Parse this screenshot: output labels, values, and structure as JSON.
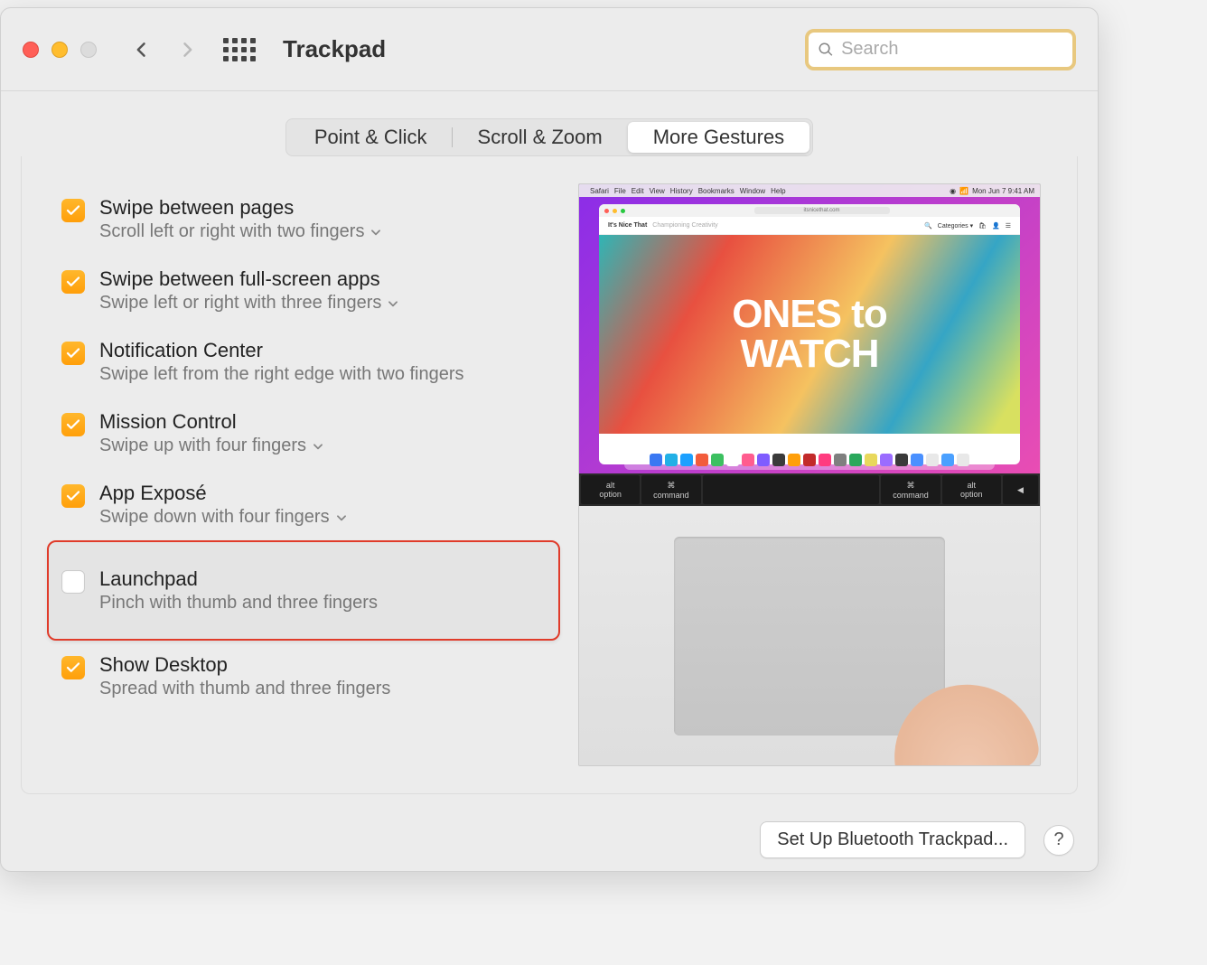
{
  "window": {
    "title": "Trackpad"
  },
  "search": {
    "placeholder": "Search"
  },
  "tabs": [
    {
      "label": "Point & Click",
      "active": false
    },
    {
      "label": "Scroll & Zoom",
      "active": false
    },
    {
      "label": "More Gestures",
      "active": true
    }
  ],
  "options": [
    {
      "title": "Swipe between pages",
      "sub": "Scroll left or right with two fingers",
      "checked": true,
      "dropdown": true
    },
    {
      "title": "Swipe between full-screen apps",
      "sub": "Swipe left or right with three fingers",
      "checked": true,
      "dropdown": true
    },
    {
      "title": "Notification Center",
      "sub": "Swipe left from the right edge with two fingers",
      "checked": true,
      "dropdown": false
    },
    {
      "title": "Mission Control",
      "sub": "Swipe up with four fingers",
      "checked": true,
      "dropdown": true
    },
    {
      "title": "App Exposé",
      "sub": "Swipe down with four fingers",
      "checked": true,
      "dropdown": true
    },
    {
      "title": "Launchpad",
      "sub": "Pinch with thumb and three fingers",
      "checked": false,
      "dropdown": false,
      "highlight": true
    },
    {
      "title": "Show Desktop",
      "sub": "Spread with thumb and three fingers",
      "checked": true,
      "dropdown": false
    }
  ],
  "preview": {
    "site": "It's Nice That",
    "hero_line1": "ONES to",
    "hero_line2": "WATCH",
    "addr": "itsnicethat.com",
    "keys": [
      "alt option",
      "⌘ command",
      "",
      "⌘ command",
      "alt option",
      "◀"
    ]
  },
  "footer": {
    "bluetooth_btn": "Set Up Bluetooth Trackpad...",
    "help": "?"
  }
}
